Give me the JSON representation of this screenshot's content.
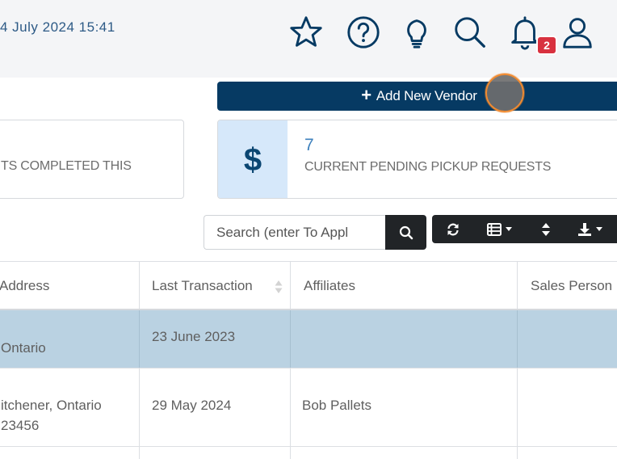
{
  "header": {
    "datetime": "4 July 2024 15:41",
    "icons": [
      "star-icon",
      "help-icon",
      "lightbulb-icon",
      "search-icon",
      "bell-icon",
      "user-icon"
    ],
    "notification_count": "2"
  },
  "actions": {
    "add_vendor_label": "Add New Vendor"
  },
  "stats": {
    "left_label": "TS COMPLETED THIS",
    "right_icon": "$",
    "right_count": "7",
    "right_label": "CURRENT PENDING PICKUP REQUESTS"
  },
  "search": {
    "placeholder": "Search (enter To Appl"
  },
  "table": {
    "columns": [
      "Address",
      "Last Transaction",
      "Affiliates",
      "Sales Person"
    ],
    "rows": [
      {
        "address_line1": "",
        "address_line2": "Ontario",
        "last_transaction": "23 June 2023",
        "affiliates": "",
        "sales_person": ""
      },
      {
        "address_line1": "itchener, Ontario",
        "address_line2": "23456",
        "last_transaction": "29 May 2024",
        "affiliates": "Bob Pallets",
        "sales_person": ""
      }
    ]
  },
  "colors": {
    "primary": "#063a63",
    "selected_row": "#bad2e2",
    "badge": "#d8313f",
    "stat_icon_bg": "#d6e8fa",
    "cursor_ring": "#f08a30"
  }
}
